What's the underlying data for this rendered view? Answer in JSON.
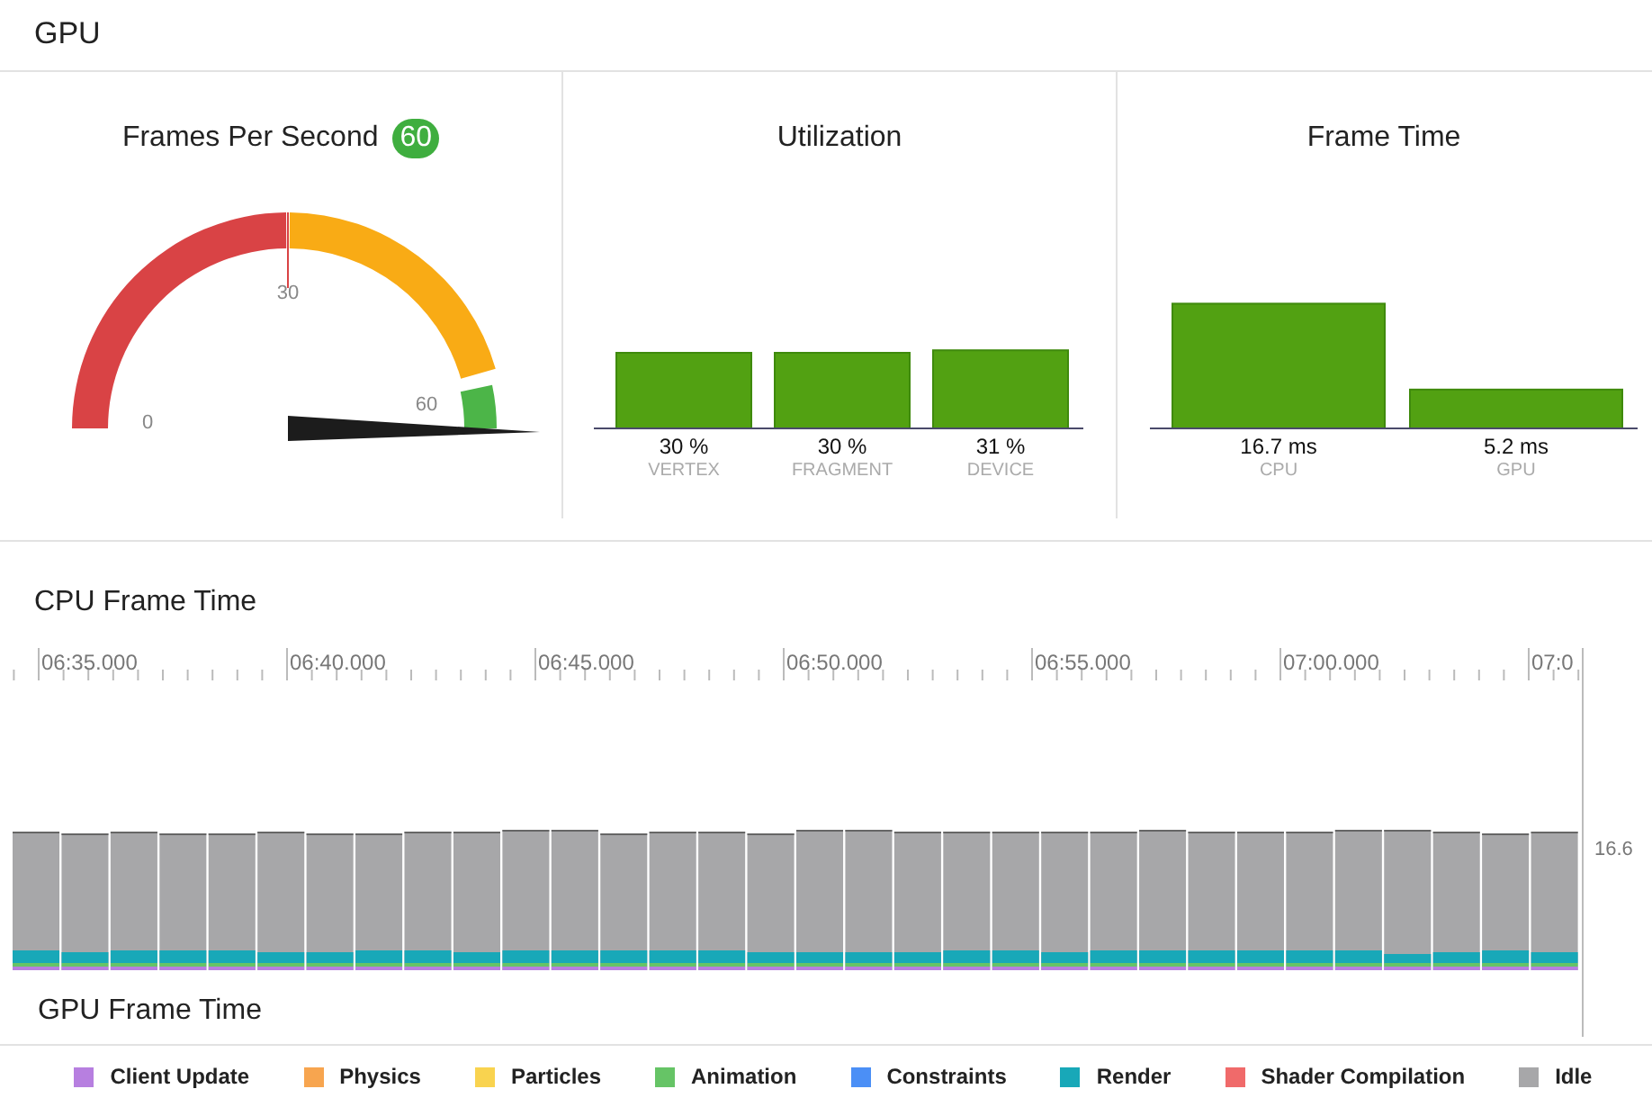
{
  "header": {
    "title": "GPU"
  },
  "fps": {
    "title": "Frames Per Second",
    "badge": "60",
    "level": 1,
    "scale_labels": [
      "0",
      "30",
      "60"
    ]
  },
  "utilization": {
    "title": "Utilization",
    "chart_data": {
      "type": "bar",
      "categories": [
        "VERTEX",
        "FRAGMENT",
        "DEVICE"
      ],
      "values": [
        30,
        30,
        31
      ],
      "data_labels": true,
      "value_labels": [
        "30 %",
        "30 %",
        "31 %"
      ]
    }
  },
  "frame_time": {
    "title": "Frame Time",
    "chart_data": {
      "type": "bar",
      "categories": [
        "CPU",
        "GPU"
      ],
      "values": [
        16.7,
        5.2
      ],
      "data_labels": true,
      "value_labels": [
        "16.7 ms",
        "5.2 ms"
      ]
    }
  },
  "cpu_frame_time": {
    "title": "CPU Frame Time",
    "time_labels": [
      "06:35.000",
      "06:40.000",
      "06:45.000",
      "06:50.000",
      "06:55.000",
      "07:00.000",
      "07:0"
    ],
    "threshold_label": "16.6"
  },
  "gpu_frame_time": {
    "title": "GPU Frame Time"
  },
  "legend": [
    {
      "label": "Client Update",
      "color": "#b77fe0"
    },
    {
      "label": "Physics",
      "color": "#f7a54f"
    },
    {
      "label": "Particles",
      "color": "#f9d34f"
    },
    {
      "label": "Animation",
      "color": "#66c466"
    },
    {
      "label": "Constraints",
      "color": "#4b8ff6"
    },
    {
      "label": "Render",
      "color": "#18a8b8"
    },
    {
      "label": "Shader Compilation",
      "color": "#f06a6a"
    },
    {
      "label": "Idle",
      "color": "#a7a7a9"
    }
  ]
}
